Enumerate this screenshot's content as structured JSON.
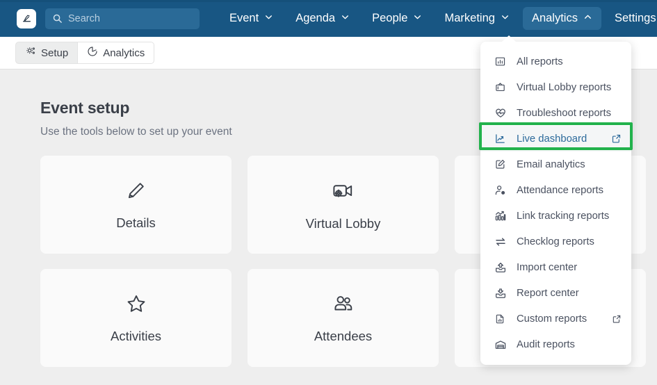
{
  "navbar": {
    "logo_icon": "brand-logo-icon",
    "search": {
      "placeholder": "Search",
      "value": "",
      "icon": "search-icon"
    },
    "items": [
      {
        "label": "Event",
        "icon": "chevron-down-icon",
        "active": false
      },
      {
        "label": "Agenda",
        "icon": "chevron-down-icon",
        "active": false
      },
      {
        "label": "People",
        "icon": "chevron-down-icon",
        "active": false
      },
      {
        "label": "Marketing",
        "icon": "chevron-down-icon",
        "active": false
      },
      {
        "label": "Analytics",
        "icon": "chevron-up-icon",
        "active": true
      },
      {
        "label": "Settings",
        "icon": "chevron-down-icon",
        "active": false
      }
    ],
    "bg_color": "#185683",
    "active_bg_color": "#2a6a97"
  },
  "tabbar": {
    "tabs": [
      {
        "label": "Setup",
        "icon": "gear-settings-icon",
        "active": true
      },
      {
        "label": "Analytics",
        "icon": "pie-chart-icon",
        "active": false
      }
    ]
  },
  "main": {
    "title": "Event setup",
    "subtitle": "Use the tools below to set up your event",
    "cards": [
      {
        "label": "Details",
        "icon": "pencil-edit-icon"
      },
      {
        "label": "Virtual Lobby",
        "icon": "video-camera-gear-icon"
      },
      {
        "label": "",
        "icon": ""
      },
      {
        "label": "Activities",
        "icon": "star-icon"
      },
      {
        "label": "Attendees",
        "icon": "people-group-icon"
      },
      {
        "label": "",
        "icon": ""
      }
    ]
  },
  "dropdown": {
    "open_for": "Analytics",
    "highlight_color": "#22b24c",
    "items": [
      {
        "label": "All reports",
        "icon": "bar-chart-icon",
        "external": false,
        "highlighted": false
      },
      {
        "label": "Virtual Lobby reports",
        "icon": "television-icon",
        "external": false,
        "highlighted": false
      },
      {
        "label": "Troubleshoot reports",
        "icon": "heart-pulse-icon",
        "external": false,
        "highlighted": false
      },
      {
        "label": "Live dashboard",
        "icon": "line-chart-up-icon",
        "external": true,
        "highlighted": true
      },
      {
        "label": "Email analytics",
        "icon": "compose-square-icon",
        "external": false,
        "highlighted": false
      },
      {
        "label": "Attendance reports",
        "icon": "person-clock-icon",
        "external": false,
        "highlighted": false
      },
      {
        "label": "Link tracking reports",
        "icon": "trend-bars-icon",
        "external": false,
        "highlighted": false
      },
      {
        "label": "Checklog reports",
        "icon": "exchange-arrows-icon",
        "external": false,
        "highlighted": false
      },
      {
        "label": "Import center",
        "icon": "upload-tray-icon",
        "external": false,
        "highlighted": false
      },
      {
        "label": "Report center",
        "icon": "download-tray-icon",
        "external": false,
        "highlighted": false
      },
      {
        "label": "Custom reports",
        "icon": "document-chart-icon",
        "external": true,
        "highlighted": false
      },
      {
        "label": "Audit reports",
        "icon": "archive-box-icon",
        "external": false,
        "highlighted": false
      }
    ]
  }
}
